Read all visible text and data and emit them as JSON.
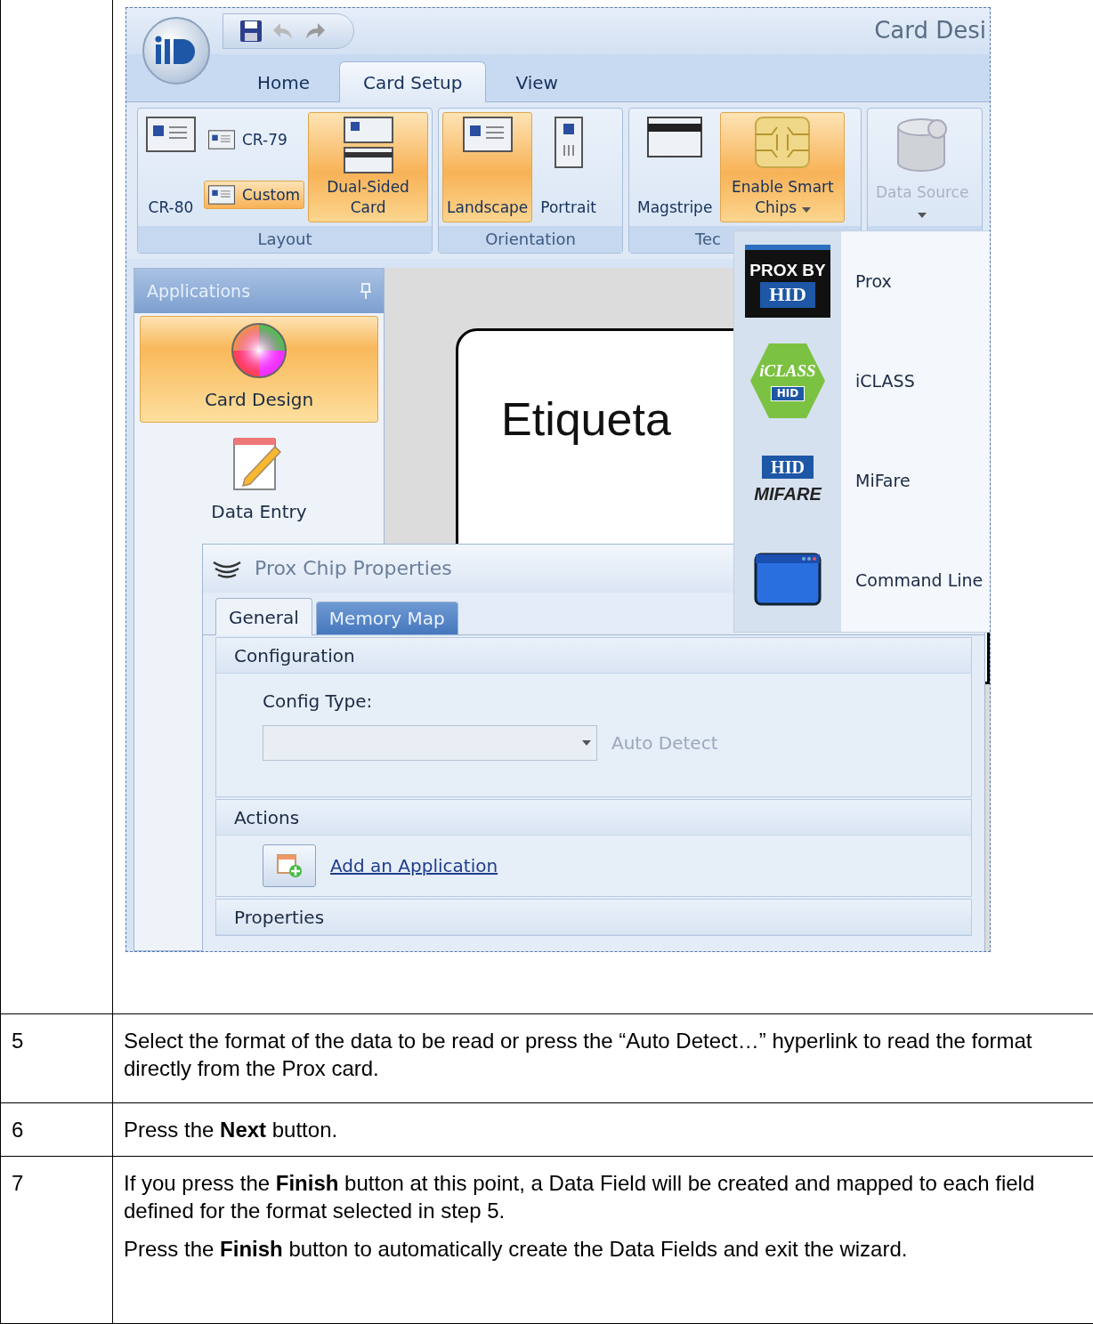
{
  "screenshot": {
    "window_title": "Card Desi",
    "tabs": [
      {
        "label": "Home",
        "selected": false
      },
      {
        "label": "Card Setup",
        "selected": true
      },
      {
        "label": "View",
        "selected": false
      }
    ],
    "ribbon_groups": [
      {
        "label": "Layout",
        "buttons": [
          {
            "label": "CR-80",
            "kind": "large",
            "active": false
          },
          {
            "label": "CR-79",
            "kind": "small",
            "active": false
          },
          {
            "label": "Custom",
            "kind": "small",
            "active": true
          },
          {
            "label": "Dual-Sided Card",
            "kind": "large",
            "active": true
          }
        ]
      },
      {
        "label": "Orientation",
        "buttons": [
          {
            "label": "Landscape",
            "kind": "large",
            "active": true
          },
          {
            "label": "Portrait",
            "kind": "large",
            "active": false
          }
        ]
      },
      {
        "label": "Tec",
        "buttons": [
          {
            "label": "Magstripe",
            "kind": "large",
            "active": false
          },
          {
            "label": "Enable Smart Chips",
            "kind": "large",
            "active": true,
            "dropdown": true
          }
        ]
      },
      {
        "buttons": [
          {
            "label": "Data Source",
            "kind": "large",
            "active": false,
            "disabled": true,
            "dropdown": true
          }
        ]
      }
    ],
    "chip_menu": [
      {
        "label": "Prox",
        "logo": [
          "PROX BY",
          "HID"
        ]
      },
      {
        "label": "iCLASS",
        "logo": [
          "iCLASS",
          "HID"
        ]
      },
      {
        "label": "MiFare",
        "logo": [
          "HID",
          "MIFARE"
        ]
      },
      {
        "label": "Command Line"
      }
    ],
    "applications": {
      "title": "Applications",
      "items": [
        {
          "label": "Card Design",
          "selected": true
        },
        {
          "label": "Data Entry",
          "selected": false
        }
      ]
    },
    "canvas": {
      "card_text": "Etiqueta"
    },
    "properties": {
      "title": "Prox Chip Properties",
      "tabs": [
        {
          "label": "General",
          "selected": true,
          "hover": false
        },
        {
          "label": "Memory Map",
          "selected": false,
          "hover": true
        }
      ],
      "sections": [
        {
          "title": "Configuration",
          "field_label": "Config Type:",
          "link": "Auto Detect",
          "link_disabled": true
        },
        {
          "title": "Actions",
          "action": "Add an Application"
        },
        {
          "title": "Properties"
        }
      ]
    }
  },
  "steps": [
    {
      "number": "5",
      "paragraphs": [
        "Select the format of the data to be read or press the “Auto Detect…” hyperlink to read the format directly from the Prox card."
      ]
    },
    {
      "number": "6",
      "paragraphs": [
        "Press the **Next** button."
      ]
    },
    {
      "number": "7",
      "paragraphs": [
        "If you press the **Finish** button at this point, a Data Field will be created and mapped to each field defined for the format selected in step 5.",
        "Press the **Finish** button to automatically create the Data Fields and exit the wizard."
      ]
    }
  ]
}
